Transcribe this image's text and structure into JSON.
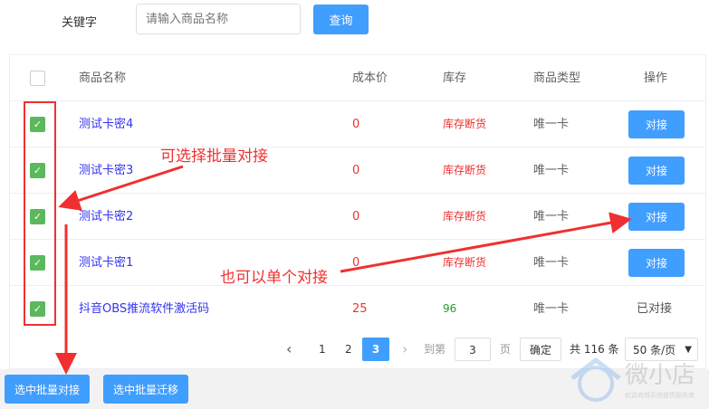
{
  "search": {
    "label": "关键字",
    "placeholder": "请输入商品名称",
    "button": "查询"
  },
  "table": {
    "headers": [
      "商品名称",
      "成本价",
      "库存",
      "商品类型",
      "操作"
    ],
    "rows": [
      {
        "name": "测试卡密4",
        "cost": "0",
        "stock": "库存断货",
        "type": "唯一卡",
        "action": "对接",
        "checked": true
      },
      {
        "name": "测试卡密3",
        "cost": "0",
        "stock": "库存断货",
        "type": "唯一卡",
        "action": "对接",
        "checked": true
      },
      {
        "name": "测试卡密2",
        "cost": "0",
        "stock": "库存断货",
        "type": "唯一卡",
        "action": "对接",
        "checked": true
      },
      {
        "name": "测试卡密1",
        "cost": "0",
        "stock": "库存断货",
        "type": "唯一卡",
        "action": "对接",
        "checked": true
      },
      {
        "name": "抖音OBS推流软件激活码",
        "cost": "25",
        "stock": "96",
        "type": "唯一卡",
        "action": "已对接",
        "checked": true
      }
    ]
  },
  "pagination": {
    "pages": [
      "1",
      "2",
      "3"
    ],
    "current": "3",
    "goto_label": "到第",
    "goto_value": "3",
    "page_unit": "页",
    "confirm": "确定",
    "total": "共 116 条",
    "page_size": "50 条/页"
  },
  "footer": {
    "batch_connect": "选中批量对接",
    "batch_migrate": "选中批量迁移"
  },
  "annotations": {
    "batch": "可选择批量对接",
    "single": "也可以单个对接"
  },
  "watermark": {
    "brand": "微小店",
    "slogan": "权益商城系统提供服务商"
  },
  "colors": {
    "primary": "#409eff",
    "link": "#3333ee",
    "danger": "#f03030",
    "success": "#2a9a2a",
    "check": "#5cb85c"
  }
}
